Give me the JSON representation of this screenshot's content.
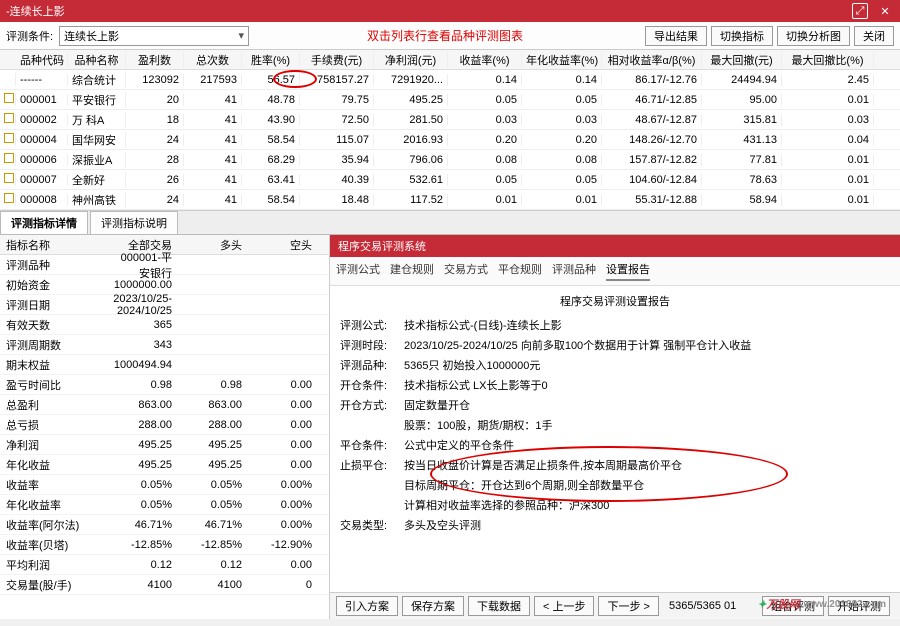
{
  "title": "-连续长上影",
  "toolbar": {
    "label": "评测条件:",
    "combo_value": "连续长上影",
    "hint": "双击列表行查看品种评测图表",
    "btn_export": "导出结果",
    "btn_switch_indicator": "切换指标",
    "btn_switch_chart": "切换分析图",
    "btn_close": "关闭"
  },
  "grid": {
    "headers": [
      "品种代码",
      "品种名称",
      "盈利数",
      "总次数",
      "胜率(%)",
      "手续费(元)",
      "净利润(元)",
      "收益率(%)",
      "年化收益率(%)",
      "相对收益率α/β(%)",
      "最大回撤(元)",
      "最大回撤比(%)"
    ],
    "rows": [
      {
        "code": "------",
        "name": "综合统计",
        "c": [
          "123092",
          "217593",
          "56.57",
          "758157.27",
          "7291920...",
          "0.14",
          "0.14",
          "86.17/-12.76",
          "24494.94",
          "2.45"
        ]
      },
      {
        "code": "000001",
        "name": "平安银行",
        "c": [
          "20",
          "41",
          "48.78",
          "79.75",
          "495.25",
          "0.05",
          "0.05",
          "46.71/-12.85",
          "95.00",
          "0.01"
        ]
      },
      {
        "code": "000002",
        "name": "万 科A",
        "c": [
          "18",
          "41",
          "43.90",
          "72.50",
          "281.50",
          "0.03",
          "0.03",
          "48.67/-12.87",
          "315.81",
          "0.03"
        ]
      },
      {
        "code": "000004",
        "name": "国华网安",
        "c": [
          "24",
          "41",
          "58.54",
          "115.07",
          "2016.93",
          "0.20",
          "0.20",
          "148.26/-12.70",
          "431.13",
          "0.04"
        ]
      },
      {
        "code": "000006",
        "name": "深振业A",
        "c": [
          "28",
          "41",
          "68.29",
          "35.94",
          "796.06",
          "0.08",
          "0.08",
          "157.87/-12.82",
          "77.81",
          "0.01"
        ]
      },
      {
        "code": "000007",
        "name": "全新好",
        "c": [
          "26",
          "41",
          "63.41",
          "40.39",
          "532.61",
          "0.05",
          "0.05",
          "104.60/-12.84",
          "78.63",
          "0.01"
        ]
      },
      {
        "code": "000008",
        "name": "神州高铁",
        "c": [
          "24",
          "41",
          "58.54",
          "18.48",
          "117.52",
          "0.01",
          "0.01",
          "55.31/-12.88",
          "58.94",
          "0.01"
        ]
      }
    ]
  },
  "tabs": {
    "t1": "评测指标详情",
    "t2": "评测指标说明"
  },
  "left": {
    "head": [
      "指标名称",
      "全部交易",
      "多头",
      "空头"
    ],
    "rows": [
      [
        "评测品种",
        "000001-平安银行",
        "",
        ""
      ],
      [
        "初始资金",
        "1000000.00",
        "",
        ""
      ],
      [
        "评测日期",
        "2023/10/25-2024/10/25",
        "",
        ""
      ],
      [
        "有效天数",
        "365",
        "",
        ""
      ],
      [
        "评测周期数",
        "343",
        "",
        ""
      ],
      [
        "期末权益",
        "1000494.94",
        "",
        ""
      ],
      [
        "盈亏时间比",
        "0.98",
        "0.98",
        "0.00"
      ],
      [
        "总盈利",
        "863.00",
        "863.00",
        "0.00"
      ],
      [
        "总亏损",
        "288.00",
        "288.00",
        "0.00"
      ],
      [
        "净利润",
        "495.25",
        "495.25",
        "0.00"
      ],
      [
        "年化收益",
        "495.25",
        "495.25",
        "0.00"
      ],
      [
        "收益率",
        "0.05%",
        "0.05%",
        "0.00%"
      ],
      [
        "年化收益率",
        "0.05%",
        "0.05%",
        "0.00%"
      ],
      [
        "收益率(阿尔法)",
        "46.71%",
        "46.71%",
        "0.00%"
      ],
      [
        "收益率(贝塔)",
        "-12.85%",
        "-12.85%",
        "-12.90%"
      ],
      [
        "平均利润",
        "0.12",
        "0.12",
        "0.00"
      ],
      [
        "交易量(股/手)",
        "4100",
        "4100",
        "0"
      ]
    ]
  },
  "right": {
    "panel_title": "程序交易评测系统",
    "sub_tabs": [
      "评测公式",
      "建仓规则",
      "交易方式",
      "平仓规则",
      "评测品种",
      "设置报告"
    ],
    "report_title": "程序交易评测设置报告",
    "lines": [
      [
        "评测公式:",
        "技术指标公式-(日线)-连续长上影"
      ],
      [
        "评测时段:",
        "2023/10/25-2024/10/25 向前多取100个数据用于计算 强制平仓计入收益"
      ],
      [
        "评测品种:",
        "5365只 初始投入1000000元"
      ],
      [
        "开仓条件:",
        "技术指标公式 LX长上影等于0"
      ],
      [
        "开仓方式:",
        "固定数量开仓"
      ],
      [
        "",
        "股票：100股，期货/期权：1手"
      ],
      [
        "平仓条件:",
        "公式中定义的平仓条件"
      ],
      [
        "止损平仓:",
        "按当日收盘价计算是否满足止损条件,按本周期最高价平仓"
      ],
      [
        "",
        "目标周期平仓：开仓达到6个周期,则全部数量平仓"
      ],
      [
        "",
        "计算相对收益率选择的参照品种：沪深300"
      ],
      [
        "",
        ""
      ],
      [
        "交易类型:",
        "多头及空头评测"
      ]
    ]
  },
  "bottom": {
    "b1": "引入方案",
    "b2": "保存方案",
    "b3": "下载数据",
    "b4": "< 上一步",
    "b5": "下一步 >",
    "status": "5365/5365 01",
    "b6": "组合评测",
    "b7": "开始评测"
  },
  "watermark": "万股网",
  "watermark_sub": "www.201082.com"
}
